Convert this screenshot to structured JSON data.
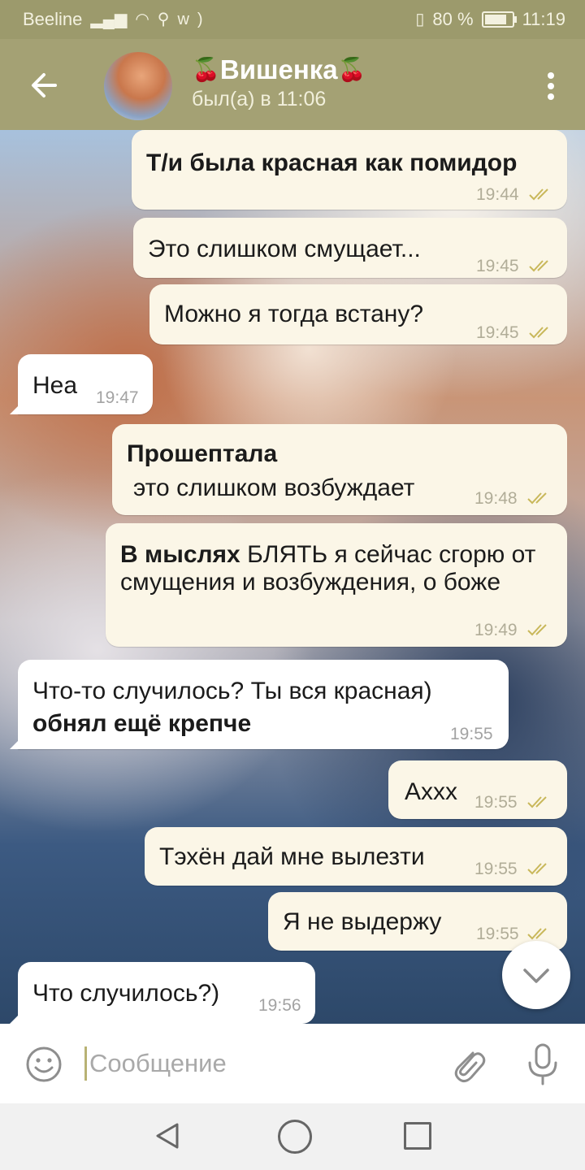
{
  "status_bar": {
    "carrier": "Beeline",
    "battery": "80 %",
    "time": "11:19"
  },
  "header": {
    "title": "Вишенка",
    "title_emoji": "🍒",
    "status": "был(а) в 11:06"
  },
  "messages": [
    {
      "dir": "out",
      "text": "Т/и была красная как помидор",
      "time": "19:44"
    },
    {
      "dir": "out",
      "text": "Это слишком смущает...",
      "time": "19:45"
    },
    {
      "dir": "out",
      "text": "Можно я тогда встану?",
      "time": "19:45"
    },
    {
      "dir": "in",
      "text": "Неа",
      "time": "19:47"
    },
    {
      "dir": "out",
      "bold": "Прошептала",
      "text": "это слишком возбуждает",
      "time": "19:48"
    },
    {
      "dir": "out",
      "bold": "В мыслях",
      "text": "БЛЯТЬ я сейчас сгорю от смущения и возбуждения, о боже",
      "time": "19:49"
    },
    {
      "dir": "in",
      "text": "Что-то случилось? Ты вся красная)",
      "bold": "обнял ещё крепче",
      "time": "19:55"
    },
    {
      "dir": "out",
      "text": "Аххх",
      "time": "19:55"
    },
    {
      "dir": "out",
      "text": "Тэхён дай мне вылезти",
      "time": "19:55"
    },
    {
      "dir": "out",
      "text": "Я не выдержу",
      "time": "19:55"
    },
    {
      "dir": "in",
      "text": "Что случилось?)",
      "time": "19:56"
    }
  ],
  "composer": {
    "placeholder": "Сообщение"
  },
  "icons": {
    "back": "arrow-left-icon",
    "menu": "more-vertical-icon",
    "emoji": "smiley-icon",
    "attach": "paperclip-icon",
    "mic": "microphone-icon",
    "scroll": "chevron-down-icon",
    "read": "double-check-icon"
  },
  "colors": {
    "header": "#a4a174",
    "status_bar": "#9c9a6c",
    "outgoing_bubble": "#fbf6e7",
    "incoming_bubble": "#ffffff",
    "check": "#c9b85b"
  }
}
